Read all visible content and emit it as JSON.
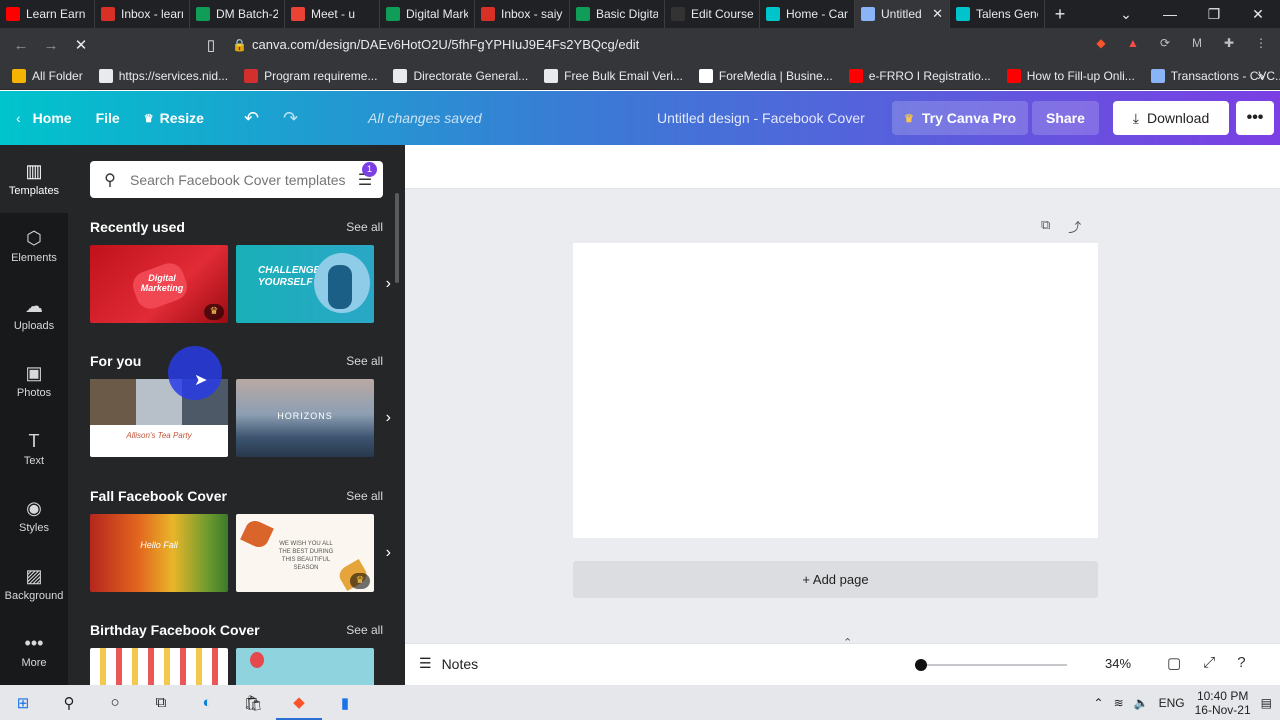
{
  "browser": {
    "tabs": [
      {
        "title": "Learn Earn",
        "icon": "youtube-icon",
        "color": "#ff0000"
      },
      {
        "title": "Inbox - learn",
        "icon": "gmail-icon",
        "color": "#d93025"
      },
      {
        "title": "DM Batch-2",
        "icon": "sheets-icon",
        "color": "#0f9d58"
      },
      {
        "title": "Meet - u",
        "icon": "meet-icon",
        "color": "#ea4335"
      },
      {
        "title": "Digital Mark",
        "icon": "sheets-icon",
        "color": "#0f9d58"
      },
      {
        "title": "Inbox - saiy",
        "icon": "gmail-icon",
        "color": "#d93025"
      },
      {
        "title": "Basic Digital",
        "icon": "sheets-icon",
        "color": "#0f9d58"
      },
      {
        "title": "Edit Course",
        "icon": "course-icon",
        "color": "#333333"
      },
      {
        "title": "Home - Can",
        "icon": "canva-icon",
        "color": "#00c4cc"
      },
      {
        "title": "Untitled",
        "icon": "loading-icon",
        "color": "#8ab4f8"
      },
      {
        "title": "Talens Gene",
        "icon": "canva-icon",
        "color": "#00c4cc"
      }
    ],
    "url": "canva.com/design/DAEv6HotO2U/5fhFgYPHIuJ9E4Fs2YBQcg/edit",
    "bookmarks": [
      {
        "label": "All Folder",
        "color": "#f4b400"
      },
      {
        "label": "https://services.nid...",
        "color": "#e8eaed"
      },
      {
        "label": "Program requireme...",
        "color": "#d32f2f"
      },
      {
        "label": "Directorate General...",
        "color": "#e8eaed"
      },
      {
        "label": "Free Bulk Email Veri...",
        "color": "#e8eaed"
      },
      {
        "label": "ForeMedia | Busine...",
        "color": "#ffffff"
      },
      {
        "label": "e-FRRO I Registratio...",
        "color": "#ff0000"
      },
      {
        "label": "How to Fill-up Onli...",
        "color": "#ff0000"
      },
      {
        "label": "Transactions - CVC...",
        "color": "#8ab4f8"
      }
    ]
  },
  "header": {
    "home": "Home",
    "file": "File",
    "resize": "Resize",
    "saved": "All changes saved",
    "title": "Untitled design - Facebook Cover",
    "pro": "Try Canva Pro",
    "share": "Share",
    "download": "Download"
  },
  "rail": [
    {
      "label": "Templates",
      "icon": "templates-icon",
      "glyph": "▥"
    },
    {
      "label": "Elements",
      "icon": "elements-icon",
      "glyph": "⬡"
    },
    {
      "label": "Uploads",
      "icon": "upload-icon",
      "glyph": "☁"
    },
    {
      "label": "Photos",
      "icon": "photos-icon",
      "glyph": "▣"
    },
    {
      "label": "Text",
      "icon": "text-icon",
      "glyph": "T"
    },
    {
      "label": "Styles",
      "icon": "styles-icon",
      "glyph": "◉"
    },
    {
      "label": "Background",
      "icon": "background-icon",
      "glyph": "▨"
    },
    {
      "label": "More",
      "icon": "more-icon",
      "glyph": "•••"
    }
  ],
  "panel": {
    "search_placeholder": "Search Facebook Cover templates",
    "filter_count": "1",
    "see_all": "See all",
    "sections": [
      {
        "title": "Recently used"
      },
      {
        "title": "For you"
      },
      {
        "title": "Fall Facebook Cover"
      },
      {
        "title": "Birthday Facebook Cover"
      }
    ],
    "thumb_text": {
      "digital_marketing": "Digital Marketing",
      "challenge": "CHALLENGE YOURSELF",
      "tea_party": "Allison's Tea Party",
      "horizons": "HORIZONS",
      "hello_fall": "Hello Fall",
      "fall_wish": "WE WISH YOU ALL THE BEST DURING THIS BEAUTIFUL SEASON"
    }
  },
  "canvas": {
    "add_page": "+ Add page"
  },
  "footer": {
    "notes": "Notes",
    "zoom": "34%"
  },
  "taskbar": {
    "lang": "ENG",
    "time": "10:40 PM",
    "date": "16-Nov-21"
  }
}
